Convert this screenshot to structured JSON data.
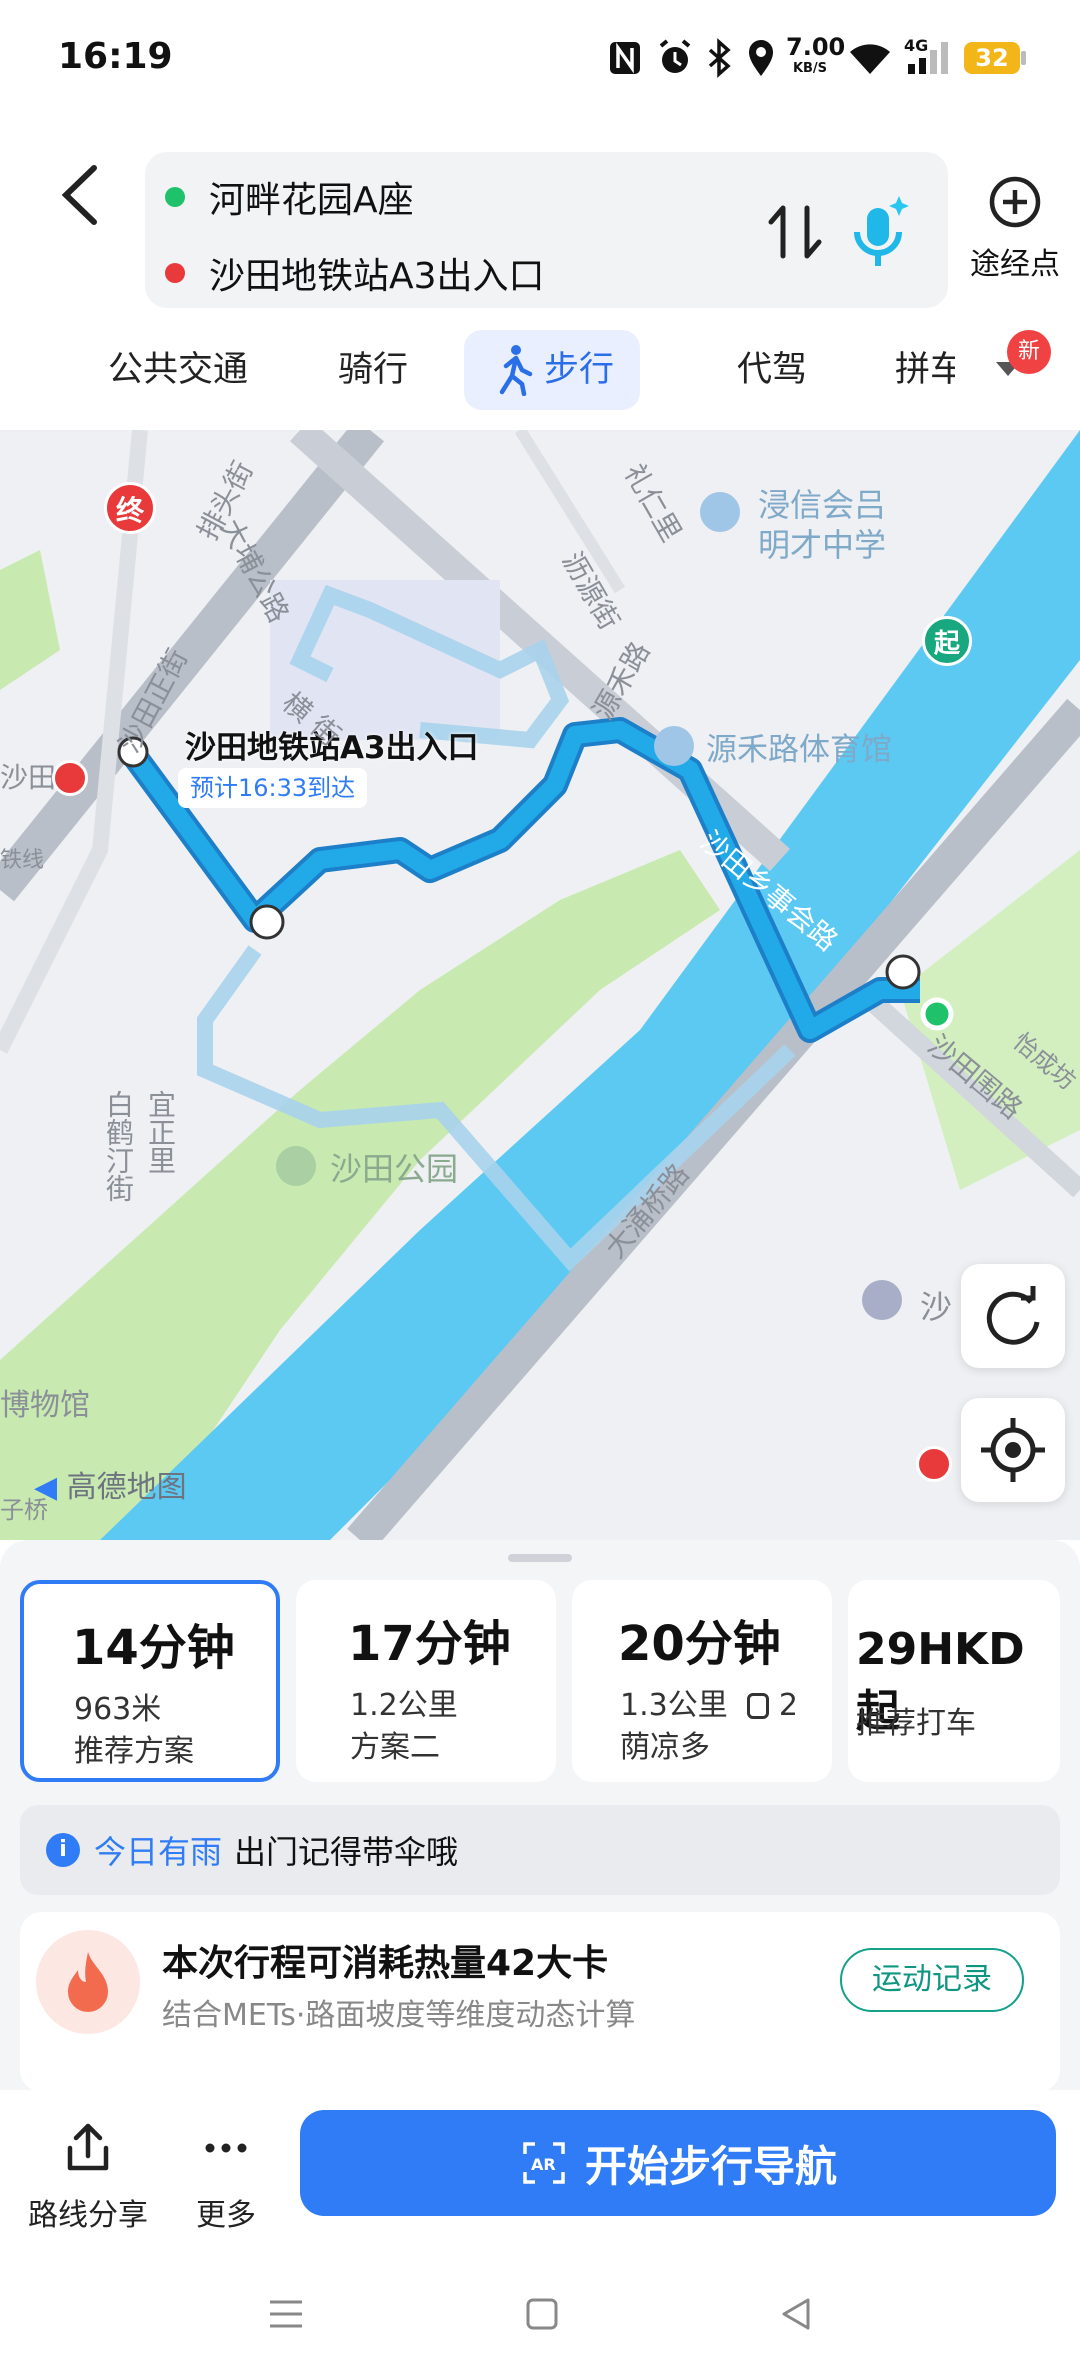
{
  "status_bar": {
    "time": "16:19",
    "net_speed": "7.00",
    "net_unit": "KB/S",
    "signal_type": "4G",
    "battery": "32"
  },
  "route": {
    "origin": "河畔花园A座",
    "destination": "沙田地铁站A3出入口",
    "origin_color": "#1fc26a",
    "destination_color": "#e83a3a",
    "waypoint_label": "途经点"
  },
  "modes": {
    "items": [
      "公共交通",
      "骑行",
      "步行",
      "代驾",
      "拼车"
    ],
    "selected": "步行",
    "new_badge": "新"
  },
  "map": {
    "destination_title": "沙田地铁站A3出入口",
    "eta": "预计16:33到达",
    "end_marker": "终",
    "start_marker": "起",
    "pois": [
      "浸信会吕",
      "明才中学",
      "源禾路体育馆",
      "沙田公园",
      "博物馆"
    ],
    "streets": [
      "排头街",
      "大埔公路",
      "沙田正街",
      "横 街",
      "礼仁里",
      "沥源街",
      "源禾路",
      "沙田乡事会路",
      "沙田围路",
      "怡成坊",
      "大涌桥路",
      "白鹤汀街",
      "宜正里",
      "沙田",
      "铁线",
      "子桥",
      "沙"
    ],
    "watermark": "高德地图"
  },
  "plans": [
    {
      "time": "14分钟",
      "line1": "963米",
      "line2": "推荐方案",
      "selected": true
    },
    {
      "time": "17分钟",
      "line1": "1.2公里",
      "line2": "方案二",
      "selected": false
    },
    {
      "time": "20分钟",
      "line1": "1.3公里",
      "line1_extra": "2",
      "line2": "荫凉多",
      "selected": false
    },
    {
      "time": "29HKD起",
      "line1": "推荐打车",
      "line2": "",
      "selected": false
    }
  ],
  "tip": {
    "highlight": "今日有雨",
    "text": "出门记得带伞哦"
  },
  "calorie": {
    "title": "本次行程可消耗热量42大卡",
    "subtitle": "结合METs·路面坡度等维度动态计算",
    "button": "运动记录"
  },
  "actions": {
    "share": "路线分享",
    "more": "更多",
    "start_nav": "开始步行导航"
  },
  "colors": {
    "accent": "#2f7cf6",
    "route_line": "#22a9e8",
    "water": "#5cc9f3",
    "park": "#c8eab0"
  }
}
